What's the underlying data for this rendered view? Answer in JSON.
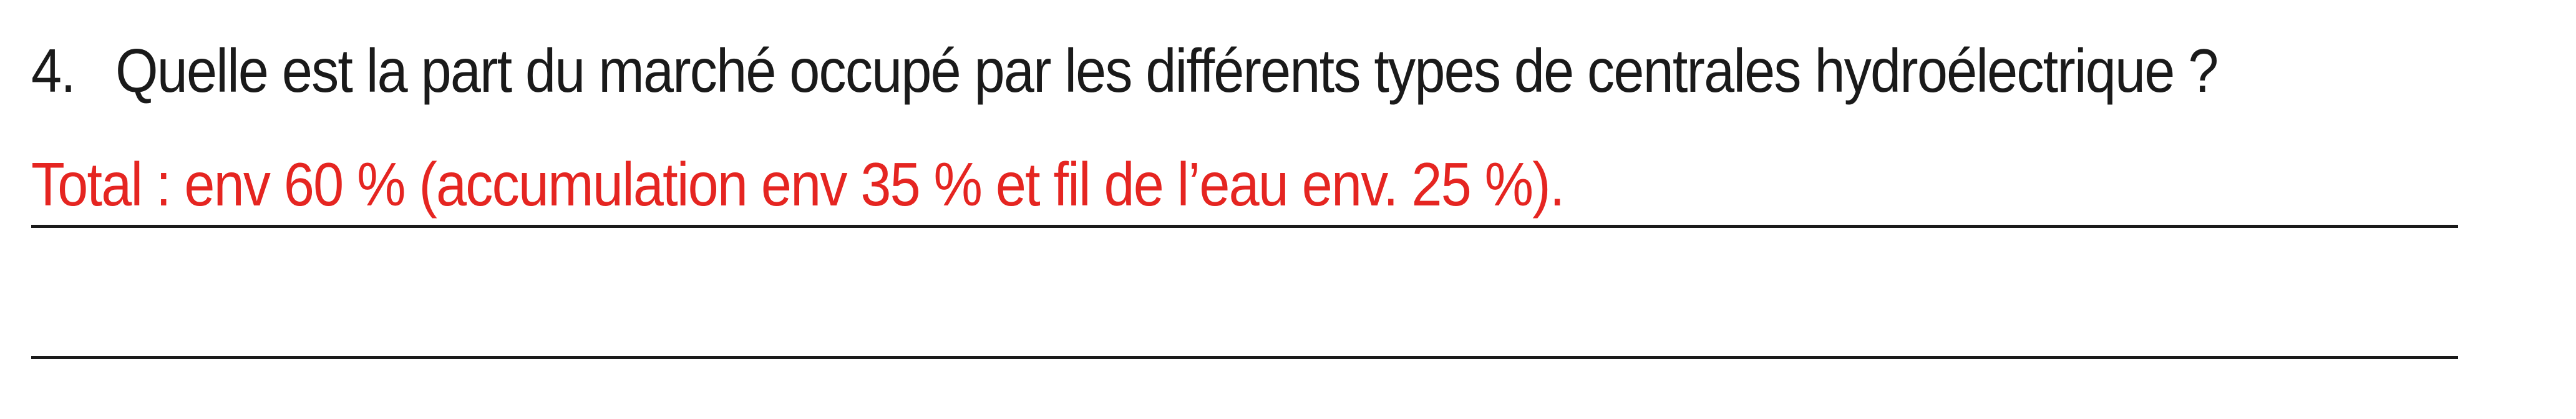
{
  "question": {
    "number": "4.",
    "text": "Quelle est la part du marché occupé par les différents types de centrales hydroélectrique ?"
  },
  "answer": {
    "lines": [
      "Total : env 60 % (accumulation env 35 % et fil de l’eau env. 25 %).",
      ""
    ]
  },
  "colors": {
    "question_text": "#1a1a1a",
    "answer_text": "#e52521",
    "rule_lines": "#1a1a1a"
  }
}
